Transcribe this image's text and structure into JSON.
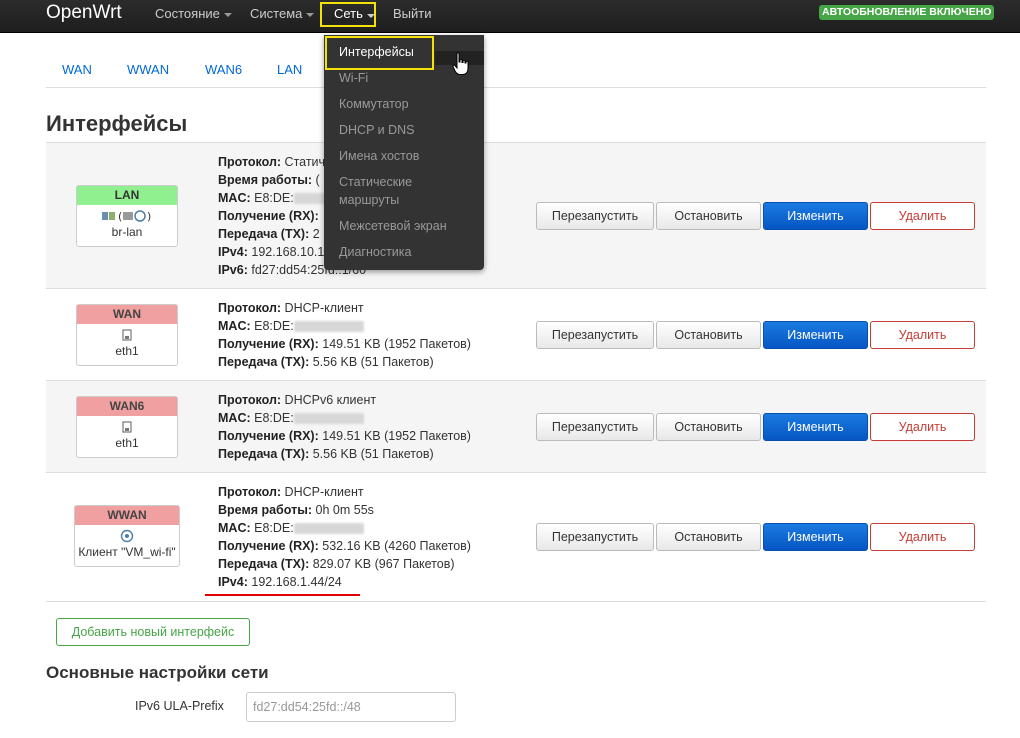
{
  "nav": {
    "brand": "OpenWrt",
    "status": "Состояние",
    "system": "Система",
    "network": "Сеть",
    "logout": "Выйти",
    "autorefresh": "АВТООБНОВЛЕНИЕ ВКЛЮЧЕНО"
  },
  "tabs": [
    "WAN",
    "WWAN",
    "WAN6",
    "LAN"
  ],
  "dropdown": {
    "items": [
      "Интерфейсы",
      "Wi-Fi",
      "Коммутатор",
      "DHCP и DNS",
      "Имена хостов",
      "Статические",
      "маршруты",
      "Межсетевой экран",
      "Диагностика"
    ]
  },
  "page_title": "Интерфейсы",
  "labels": {
    "protocol": "Протокол:",
    "uptime": "Время работы:",
    "mac": "MAC:",
    "rx": "Получение (RX):",
    "tx": "Передача (TX):",
    "ipv4": "IPv4:",
    "ipv6": "IPv6:"
  },
  "buttons": {
    "restart": "Перезапустить",
    "stop": "Остановить",
    "edit": "Изменить",
    "delete": "Удалить",
    "add": "Добавить новый интерфейс"
  },
  "interfaces": [
    {
      "name": "LAN",
      "device": "br-lan",
      "protocol": "Статич",
      "uptime": "(",
      "mac": "E8:DE:",
      "rx": "",
      "tx": "2",
      "ipv4": "192.168.10.1",
      "ipv6": "fd27:dd54:25fd::1/60"
    },
    {
      "name": "WAN",
      "device": "eth1",
      "protocol": "DHCP-клиент",
      "mac": "E8:DE:",
      "rx": "149.51 KB (1952 Пакетов)",
      "tx": "5.56 KB (51 Пакетов)"
    },
    {
      "name": "WAN6",
      "device": "eth1",
      "protocol": "DHCPv6 клиент",
      "mac": "E8:DE:",
      "rx": "149.51 KB (1952 Пакетов)",
      "tx": "5.56 KB (51 Пакетов)"
    },
    {
      "name": "WWAN",
      "device": "Клиент \"VM_wi-fi\"",
      "protocol": "DHCP-клиент",
      "uptime": "0h 0m 55s",
      "mac": "E8:DE:",
      "rx": "532.16 KB (4260 Пакетов)",
      "tx": "829.07 KB (967 Пакетов)",
      "ipv4": "192.168.1.44/24"
    }
  ],
  "general": {
    "title": "Основные настройки сети",
    "ula_label": "IPv6 ULA-Prefix",
    "ula_value": "fd27:dd54:25fd::/48"
  },
  "colors": {
    "lan_header": "#90f090",
    "wan_header": "#f0a0a0",
    "primary": "#0656c4",
    "danger": "#c43c35",
    "success": "#46a546",
    "highlight": "#f5e10a"
  }
}
